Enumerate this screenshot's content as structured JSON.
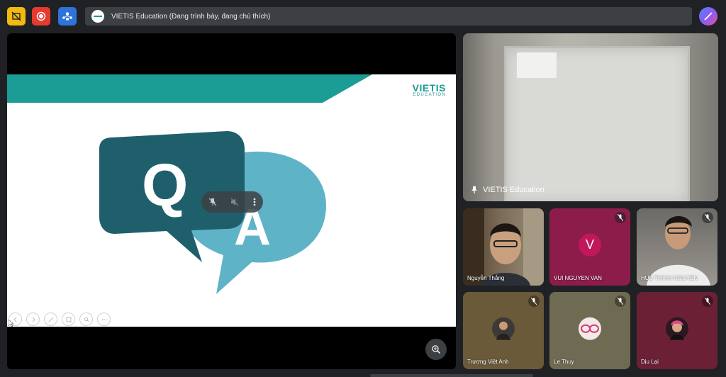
{
  "meeting": {
    "title": "VIETIS Education (Đang trình bày, đang chú thích)"
  },
  "toolbar": {
    "icons": [
      "stop-share-icon",
      "record-icon",
      "participants-icon",
      "effects-icon"
    ],
    "colors": {
      "stop_share": "#f2b90f",
      "record": "#e53a2f",
      "participants": "#2c74d9"
    }
  },
  "slide": {
    "brand_name": "VIETIS",
    "brand_sub": "EDUCATION",
    "q_letter": "Q",
    "a_letter": "A",
    "teal_color": "#1b9c95",
    "dark_bubble_color": "#1f5f6b",
    "light_bubble_color": "#5fb3c7"
  },
  "main_tile": {
    "name": "VIETIS Education"
  },
  "participants": [
    {
      "name": "Nguyễn Thắng",
      "kind": "video",
      "muted": false
    },
    {
      "name": "VUI NGUYEN VAN",
      "kind": "letter",
      "letter": "V",
      "bg": "#8c1d4b",
      "avatar_bg": "#c0185a",
      "muted": true
    },
    {
      "name": "HUU THINH NGUYEN",
      "kind": "video",
      "muted": true
    },
    {
      "name": "Trương Việt Anh",
      "kind": "photo",
      "bg": "#6a5a3a",
      "muted": true
    },
    {
      "name": "Le Thuy",
      "kind": "photo",
      "bg": "#6f6a52",
      "muted": true
    },
    {
      "name": "Dịu Lại",
      "kind": "photo",
      "bg": "#6b2035",
      "muted": true
    }
  ]
}
